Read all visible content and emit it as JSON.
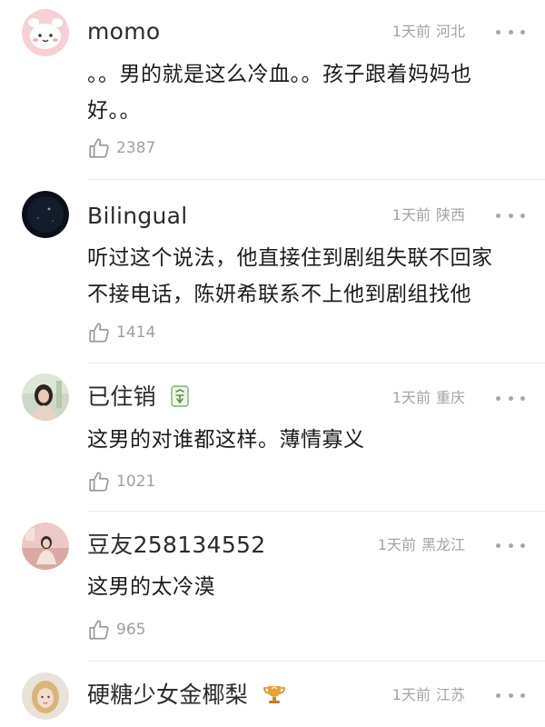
{
  "comments": [
    {
      "username": "momo",
      "time": "1天前",
      "location": "河北",
      "text_lines": [
        "。。男的就是这么冷血。。孩子跟着妈妈也",
        "好。。"
      ],
      "likes": "2387",
      "avatar_icon": "pink-cartoon-face-icon",
      "badge_icon": null
    },
    {
      "username": "Bilingual",
      "time": "1天前",
      "location": "陕西",
      "text_lines": [
        "听过这个说法，他直接住到剧组失联不回家",
        "不接电话，陈妍希联系不上他到剧组找他"
      ],
      "likes": "1414",
      "avatar_icon": "night-sky-photo-icon",
      "badge_icon": null
    },
    {
      "username": "已住销",
      "time": "1天前",
      "location": "重庆",
      "text_lines": [
        "这男的对谁都这样。薄情寡义"
      ],
      "likes": "1021",
      "avatar_icon": "girl-photo-icon",
      "badge_icon": "mahjong-tile-icon"
    },
    {
      "username": "豆友258134552",
      "time": "1天前",
      "location": "黑龙江",
      "text_lines": [
        "这男的太冷漠"
      ],
      "likes": "965",
      "avatar_icon": "pink-room-photo-icon",
      "badge_icon": null
    },
    {
      "username": "硬糖少女金椰梨",
      "time": "1天前",
      "location": "江苏",
      "text_lines": [],
      "likes": null,
      "avatar_icon": "blonde-girl-photo-icon",
      "badge_icon": "golden-trophy-icon"
    }
  ],
  "colors": {
    "text": "#1c1c1c",
    "username": "#2b2b2b",
    "meta": "#a3a3a3",
    "divider": "#ececec",
    "icon": "#a8a8a8"
  }
}
